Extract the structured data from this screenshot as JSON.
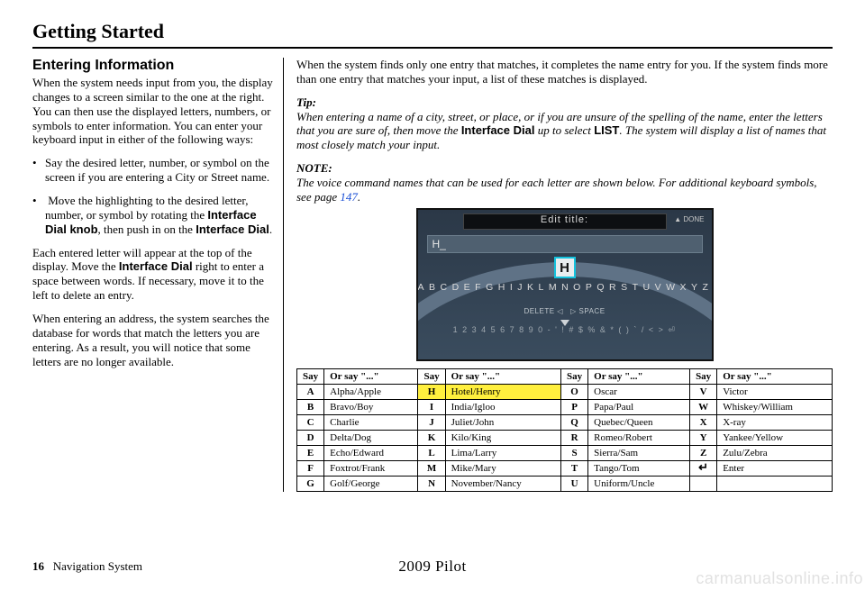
{
  "chapter": "Getting Started",
  "section": "Entering Information",
  "left": {
    "p1": "When the system needs input from you, the display changes to a screen similar to the one at the right. You can then use the displayed letters, numbers, or symbols to enter information. You can enter your keyboard input in either of the following ways:",
    "b1": "Say the desired letter, number, or symbol on the screen if you are entering a City or Street name.",
    "b2a": "Move the highlighting to the desired letter, number, or symbol by rotating the ",
    "b2b": "Interface Dial knob",
    "b2c": ", then push in on the ",
    "b2d": "Interface Dial",
    "b2e": ".",
    "p2a": "Each entered letter will appear at the top of the display. Move the ",
    "p2b": "Interface Dial",
    "p2c": " right to enter a space between words. If necessary, move it to the left to delete an entry.",
    "p3": "When entering an address, the system searches the database for words that match the letters you are entering. As a result, you will notice that some letters are no longer available."
  },
  "right": {
    "p1": "When the system finds only one entry that matches, it completes the name entry for you. If the system finds more than one entry that matches your input, a list of these matches is displayed.",
    "tip_head": "Tip:",
    "tip_a": "When entering a name of a city, street, or place, or if you are unsure of the spelling of the name, enter the letters that you are sure of, then move the ",
    "tip_b": "Interface Dial",
    "tip_c": " up to select ",
    "tip_d": "LIST",
    "tip_e": ". The system will display a list of names that most closely match your input.",
    "note_head": "NOTE:",
    "note_a": "The voice command names that can be used for each letter are shown below. For additional keyboard symbols, see page ",
    "note_link": "147",
    "note_b": "."
  },
  "screen": {
    "title": "Edit title:",
    "done": "▲ DONE",
    "field": "H_",
    "selected": "H",
    "arc": "A B C D E F G H I J K L M N O P Q R S T U V W X Y Z",
    "del": "DELETE",
    "space": "SPACE",
    "numrow": "1 2 3 4 5 6 7 8 9 0 - ' ! # $ % & * ( ) ` / < > ⏎"
  },
  "table": {
    "hdr_say": "Say",
    "hdr_or": "Or say \"...\"",
    "rows": [
      {
        "c1": "A",
        "c2": "Alpha/Apple",
        "c3": "H",
        "c4": "Hotel/Henry",
        "c5": "O",
        "c6": "Oscar",
        "c7": "V",
        "c8": "Victor",
        "hl": true
      },
      {
        "c1": "B",
        "c2": "Bravo/Boy",
        "c3": "I",
        "c4": "India/Igloo",
        "c5": "P",
        "c6": "Papa/Paul",
        "c7": "W",
        "c8": "Whiskey/William"
      },
      {
        "c1": "C",
        "c2": "Charlie",
        "c3": "J",
        "c4": "Juliet/John",
        "c5": "Q",
        "c6": "Quebec/Queen",
        "c7": "X",
        "c8": "X-ray"
      },
      {
        "c1": "D",
        "c2": "Delta/Dog",
        "c3": "K",
        "c4": "Kilo/King",
        "c5": "R",
        "c6": "Romeo/Robert",
        "c7": "Y",
        "c8": "Yankee/Yellow"
      },
      {
        "c1": "E",
        "c2": "Echo/Edward",
        "c3": "L",
        "c4": "Lima/Larry",
        "c5": "S",
        "c6": "Sierra/Sam",
        "c7": "Z",
        "c8": "Zulu/Zebra"
      },
      {
        "c1": "F",
        "c2": "Foxtrot/Frank",
        "c3": "M",
        "c4": "Mike/Mary",
        "c5": "T",
        "c6": "Tango/Tom",
        "c7": "⏎",
        "c8": "Enter",
        "sym": true
      },
      {
        "c1": "G",
        "c2": "Golf/George",
        "c3": "N",
        "c4": "November/Nancy",
        "c5": "U",
        "c6": "Uniform/Uncle",
        "c7": "",
        "c8": ""
      }
    ]
  },
  "footer": {
    "pagenum": "16",
    "section": "Navigation System",
    "model": "2009  Pilot",
    "watermark": "carmanualsonline.info"
  }
}
